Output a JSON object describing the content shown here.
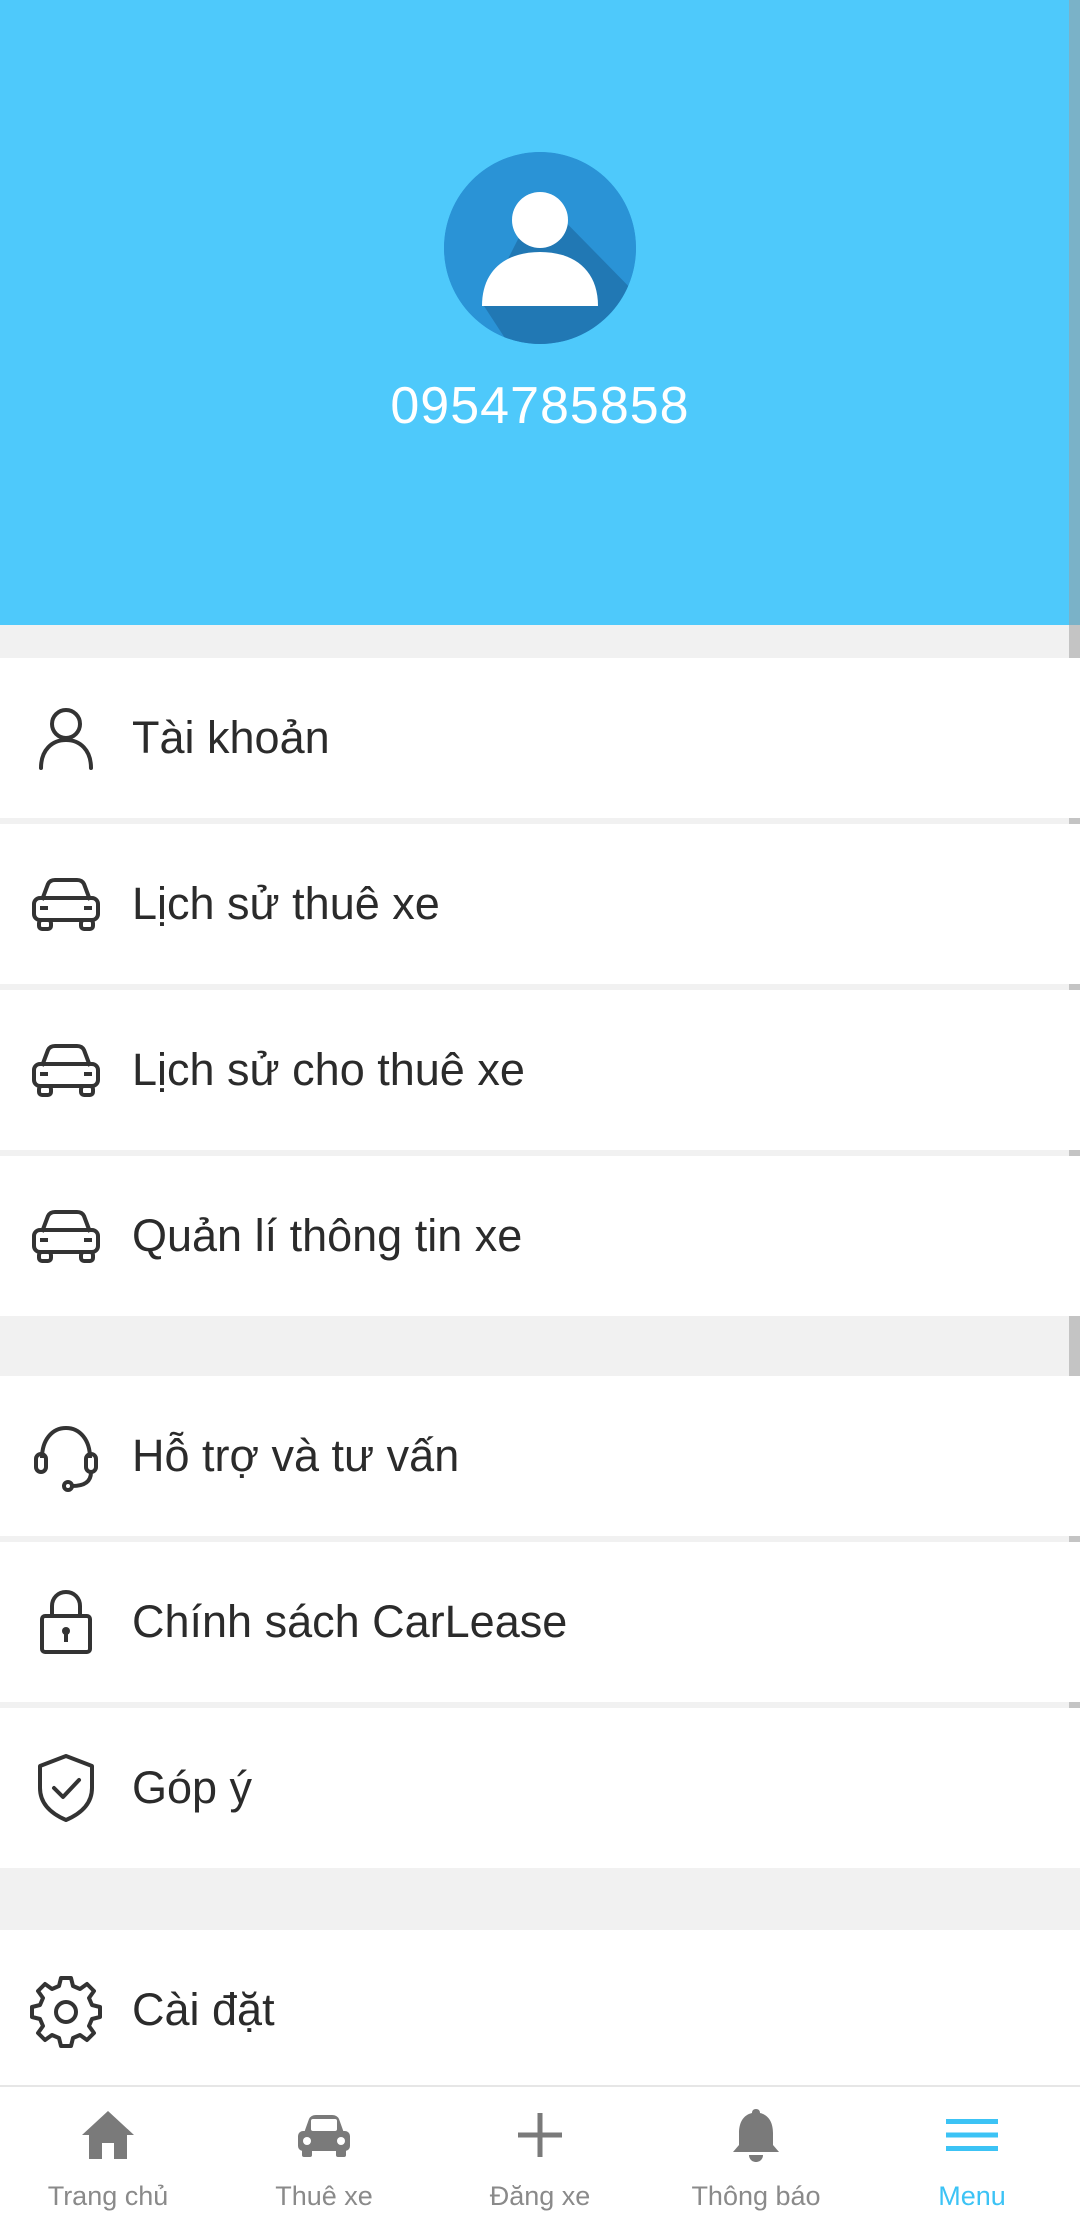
{
  "profile": {
    "phone": "0954785858",
    "icon": "user-avatar-icon"
  },
  "menu": [
    {
      "key": "account",
      "label": "Tài khoản",
      "icon": "user-icon"
    },
    {
      "key": "rent-history",
      "label": "Lịch sử thuê xe",
      "icon": "car-icon"
    },
    {
      "key": "lease-history",
      "label": "Lịch sử cho thuê xe",
      "icon": "car-icon"
    },
    {
      "key": "car-info",
      "label": "Quản lí thông tin xe",
      "icon": "car-icon"
    },
    {
      "key": "support",
      "label": "Hỗ trợ và tư vấn",
      "icon": "headset-icon"
    },
    {
      "key": "policy",
      "label": "Chính sách CarLease",
      "icon": "lock-icon"
    },
    {
      "key": "feedback",
      "label": "Góp ý",
      "icon": "shield-check-icon"
    },
    {
      "key": "settings",
      "label": "Cài đặt",
      "icon": "gear-icon"
    }
  ],
  "bottom_nav": [
    {
      "label": "Trang chủ",
      "icon": "home-icon",
      "active": false
    },
    {
      "label": "Thuê xe",
      "icon": "car-icon",
      "active": false
    },
    {
      "label": "Đăng xe",
      "icon": "plus-icon",
      "active": false
    },
    {
      "label": "Thông báo",
      "icon": "bell-icon",
      "active": false
    },
    {
      "label": "Menu",
      "icon": "menu-icon",
      "active": true
    }
  ],
  "colors": {
    "header": "#4ec9fb",
    "accent": "#3cc3f5",
    "nav_inactive": "#8a8a8a",
    "icon_dark": "#333333"
  }
}
